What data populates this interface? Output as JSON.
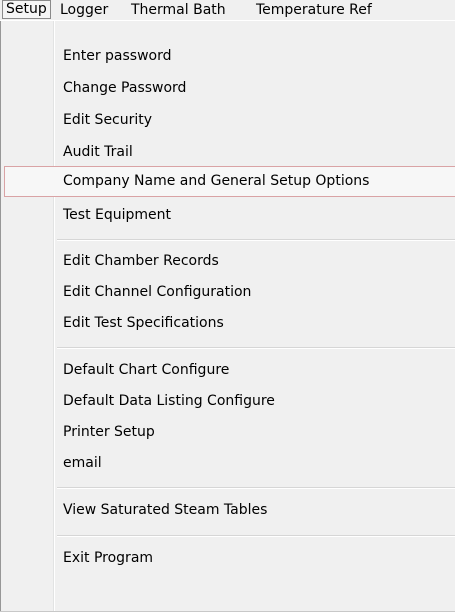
{
  "menubar": {
    "items": [
      {
        "label": "Setup"
      },
      {
        "label": "Logger"
      },
      {
        "label": "Thermal Bath"
      },
      {
        "label": "Temperature Ref"
      }
    ]
  },
  "dropdown": {
    "items": [
      {
        "label": "Enter password"
      },
      {
        "label": "Change Password"
      },
      {
        "label": "Edit Security"
      },
      {
        "label": "Audit Trail"
      },
      {
        "label": "Company Name and General Setup Options"
      },
      {
        "label": "Test Equipment"
      },
      {
        "label": "Edit Chamber Records"
      },
      {
        "label": "Edit Channel Configuration"
      },
      {
        "label": "Edit Test Specifications"
      },
      {
        "label": "Default Chart Configure"
      },
      {
        "label": "Default Data Listing Configure"
      },
      {
        "label": "Printer Setup"
      },
      {
        "label": "email"
      },
      {
        "label": "View Saturated Steam Tables"
      },
      {
        "label": "Exit Program"
      }
    ]
  }
}
